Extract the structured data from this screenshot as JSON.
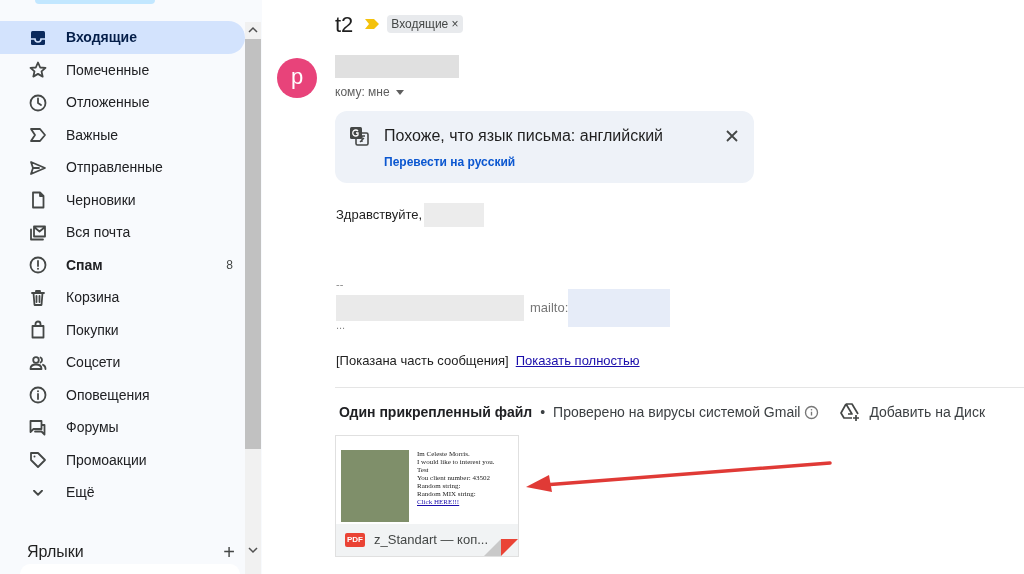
{
  "sidebar": {
    "items": [
      {
        "label": "Входящие",
        "kind": "inbox",
        "selected": true,
        "bold": true
      },
      {
        "label": "Помеченные",
        "kind": "star",
        "selected": false,
        "bold": false
      },
      {
        "label": "Отложенные",
        "kind": "clock",
        "selected": false,
        "bold": false
      },
      {
        "label": "Важные",
        "kind": "important",
        "selected": false,
        "bold": false
      },
      {
        "label": "Отправленные",
        "kind": "send",
        "selected": false,
        "bold": false
      },
      {
        "label": "Черновики",
        "kind": "file",
        "selected": false,
        "bold": false
      },
      {
        "label": "Вся почта",
        "kind": "allmail",
        "selected": false,
        "bold": false
      },
      {
        "label": "Спам",
        "kind": "spam",
        "selected": false,
        "bold": true,
        "count": "8"
      },
      {
        "label": "Корзина",
        "kind": "trash",
        "selected": false,
        "bold": false
      },
      {
        "label": "Покупки",
        "kind": "bag",
        "selected": false,
        "bold": false
      },
      {
        "label": "Соцсети",
        "kind": "people",
        "selected": false,
        "bold": false
      },
      {
        "label": "Оповещения",
        "kind": "info",
        "selected": false,
        "bold": false
      },
      {
        "label": "Форумы",
        "kind": "forum",
        "selected": false,
        "bold": false
      },
      {
        "label": "Промоакции",
        "kind": "tag",
        "selected": false,
        "bold": false
      },
      {
        "label": "Ещё",
        "kind": "chevron",
        "selected": false,
        "bold": false
      }
    ],
    "labels_heading": "Ярлыки",
    "labels_add": "+"
  },
  "message": {
    "subject": "t2",
    "important": true,
    "label_chip": "Входящие",
    "label_chip_close": "×",
    "avatar_letter": "p",
    "recipient": "кому: мне",
    "translate": {
      "text": "Похоже, что язык письма: английский",
      "link": "Перевести на русский"
    },
    "greeting": "Здравствуйте,",
    "signature_dash": "--",
    "mailto": "mailto:",
    "ellipsis": "...",
    "clipped_note": "[Показана часть сообщения]",
    "show_full": "Показать полностью"
  },
  "attachments": {
    "heading": "Один прикрепленный файл",
    "separator": "•",
    "scan_note": "Проверено на вирусы системой Gmail",
    "add_to_drive": "Добавить на Диск",
    "files": [
      {
        "name": "z_Standart — коп...",
        "type_badge": "PDF",
        "preview_lines": [
          "Im Celeste Morris.",
          "I would like to interest you.",
          "Test",
          "You client number: 43502",
          "Random string:",
          "Random MIX string:",
          "Click HERE!!!"
        ]
      }
    ]
  }
}
